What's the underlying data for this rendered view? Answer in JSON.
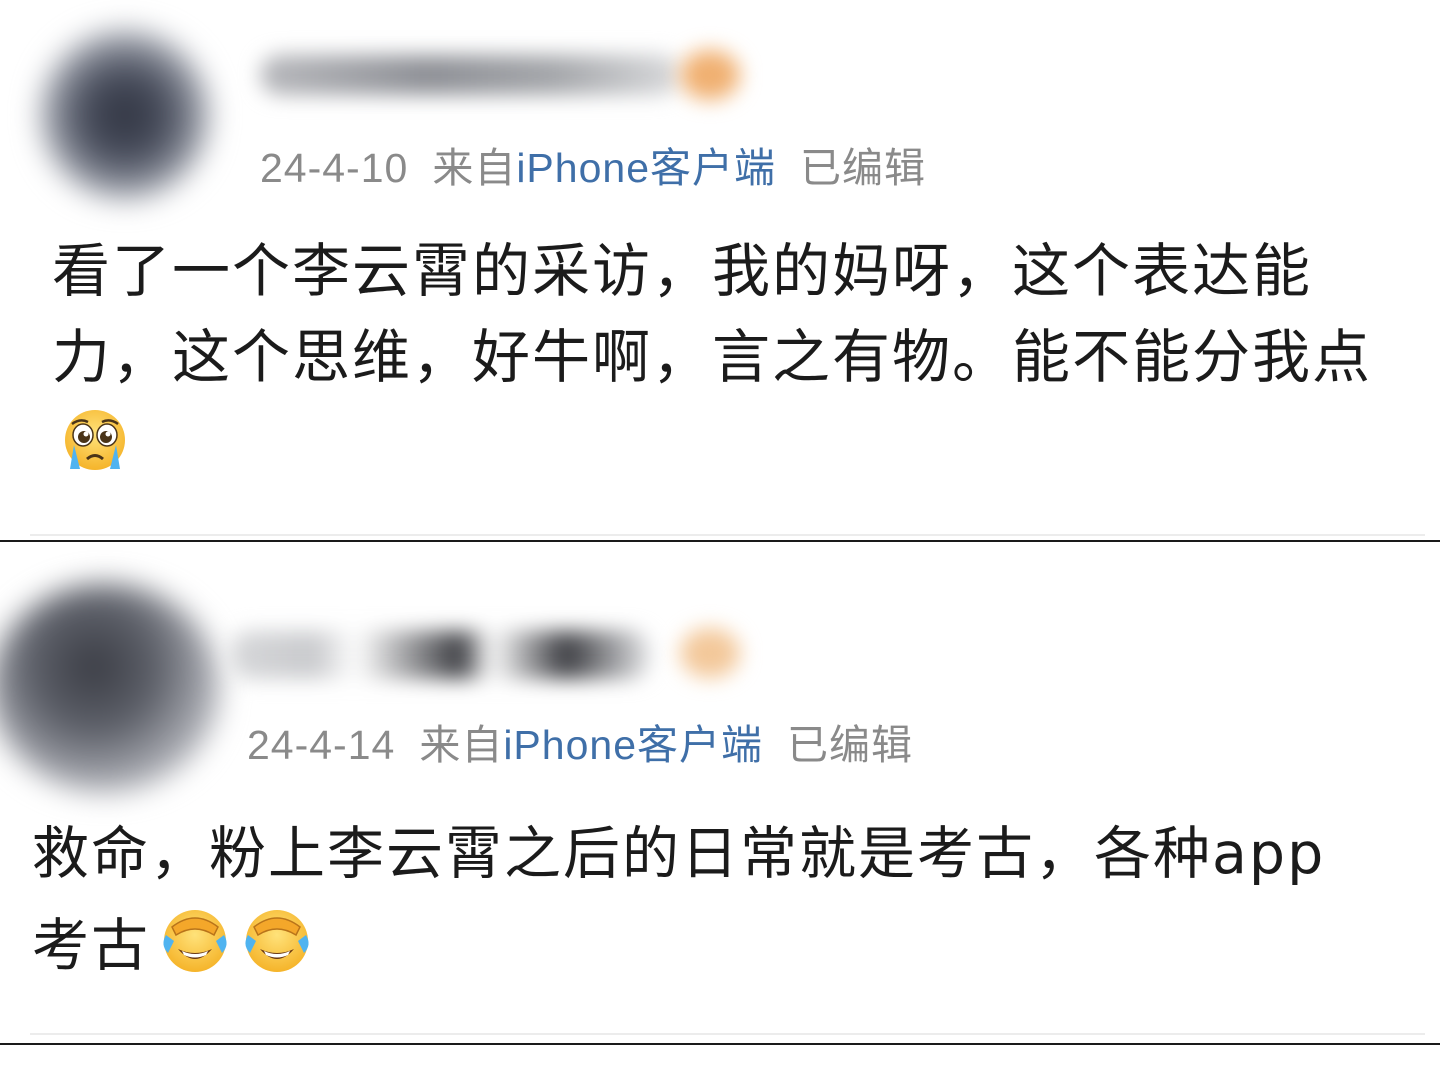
{
  "comments": [
    {
      "date": "24-4-10",
      "from_label": "来自",
      "device": "iPhone客户端",
      "edited_label": "已编辑",
      "text": "看了一个李云霄的采访，我的妈呀，这个表达能力，这个思维，好牛啊，言之有物。能不能分我点",
      "emojis": [
        "crying-pleading-face-icon"
      ]
    },
    {
      "date": "24-4-14",
      "from_label": "来自",
      "device": "iPhone客户端",
      "edited_label": "已编辑",
      "text": "救命，粉上李云霄之后的日常就是考古，各种app考古",
      "emojis": [
        "face-palm-laughing-icon",
        "face-palm-laughing-icon"
      ]
    }
  ],
  "colors": {
    "meta_gray": "#8a8a8a",
    "device_blue": "#3f6fa8",
    "text": "#1b1b1b",
    "divider": "#1a1a1a"
  }
}
